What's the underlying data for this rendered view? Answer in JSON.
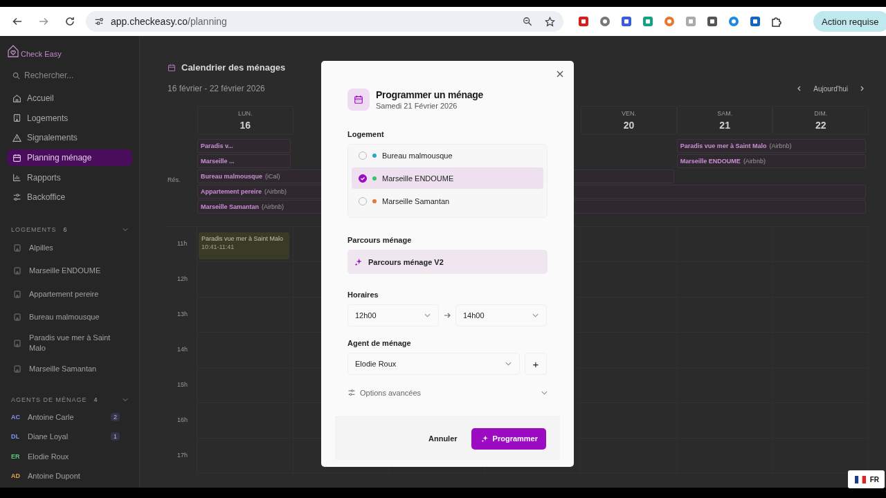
{
  "browser": {
    "url_domain": "app.checkeasy.co",
    "url_path": "/planning",
    "action_button": "Action requise"
  },
  "sidebar": {
    "logo": "Check Easy",
    "search_placeholder": "Rechercher...",
    "nav": [
      {
        "label": "Accueil",
        "kind": "home",
        "selected": false
      },
      {
        "label": "Logements",
        "kind": "building",
        "selected": false
      },
      {
        "label": "Signalements",
        "kind": "warning",
        "selected": false
      },
      {
        "label": "Planning ménage",
        "kind": "calendar",
        "selected": true
      },
      {
        "label": "Rapports",
        "kind": "chart",
        "selected": false
      },
      {
        "label": "Backoffice",
        "kind": "sliders",
        "selected": false
      }
    ],
    "logements": {
      "title": "LOGEMENTS",
      "count": "6",
      "items": [
        "Alpilles",
        "Marseille ENDOUME",
        "Appartement pereire",
        "Bureau malmousque",
        "Paradis vue mer à Saint Malo",
        "Marseille Samantan"
      ]
    },
    "agents": {
      "title": "AGENTS DE MÉNAGE",
      "count": "4",
      "items": [
        {
          "initials": "AC",
          "name": "Antoine Carle",
          "count": "2",
          "color": "#8a8ee8"
        },
        {
          "initials": "DL",
          "name": "Diane Loyal",
          "count": "1",
          "color": "#7a9af0"
        },
        {
          "initials": "ER",
          "name": "Elodie Roux",
          "color": "#5cc878"
        },
        {
          "initials": "AD",
          "name": "Antoine Dupont",
          "color": "#e0a050"
        }
      ]
    }
  },
  "calendar": {
    "title": "Calendrier des ménages",
    "range": "16 février - 22 février 2026",
    "today_button": "Aujourd'hui",
    "days": [
      {
        "label": "LUN.",
        "number": "16"
      },
      {
        "label": "VEN.",
        "number": "20"
      },
      {
        "label": "SAM.",
        "number": "21"
      },
      {
        "label": "DIM.",
        "number": "22"
      }
    ],
    "reservations_label": "Rés.",
    "reservation_rows": [
      {
        "items": [
          {
            "name": "Paradis v...",
            "kind": "monday"
          },
          {
            "name": "Paradis vue mer à Saint Malo",
            "source": "(Airbnb)",
            "kind": "weekend"
          }
        ]
      },
      {
        "items": [
          {
            "name": "Marseille ...",
            "kind": "monday"
          },
          {
            "name": "Marseille ENDOUME",
            "source": "(Airbnb)",
            "kind": "weekend"
          }
        ]
      },
      {
        "items": [
          {
            "name": "Bureau malmousque",
            "source": "(iCal)",
            "kind": "to_friday"
          }
        ]
      },
      {
        "items": [
          {
            "name": "Appartement pereire",
            "source": "(Airbnb)",
            "kind": "week"
          }
        ]
      },
      {
        "items": [
          {
            "name": "Marseille Samantan",
            "source": "(Airbnb)",
            "kind": "week"
          }
        ]
      }
    ],
    "hours": [
      "11h",
      "12h",
      "13h",
      "14h",
      "15h",
      "16h",
      "17h"
    ],
    "event": {
      "title": "Paradis vue mer à Saint Malo",
      "time": "10:41-11:41"
    }
  },
  "modal": {
    "title": "Programmer un ménage",
    "subtitle": "Samedi 21 Février 2026",
    "logement_label": "Logement",
    "logement_options": [
      {
        "name": "Bureau malmousque",
        "color": "#2aa9c0",
        "selected": false
      },
      {
        "name": "Marseille ENDOUME",
        "color": "#3cbf6e",
        "selected": true
      },
      {
        "name": "Marseille Samantan",
        "color": "#e07b39",
        "selected": false
      }
    ],
    "parcours_label": "Parcours ménage",
    "parcours_value": "Parcours ménage V2",
    "horaires_label": "Horaires",
    "start_time": "12h00",
    "end_time": "14h00",
    "agent_label": "Agent de ménage",
    "agent_value": "Elodie Roux",
    "add_button": "+",
    "advanced_options": "Options avancées",
    "cancel_button": "Annuler",
    "submit_button": "Programmer"
  },
  "language_badge": "FR"
}
